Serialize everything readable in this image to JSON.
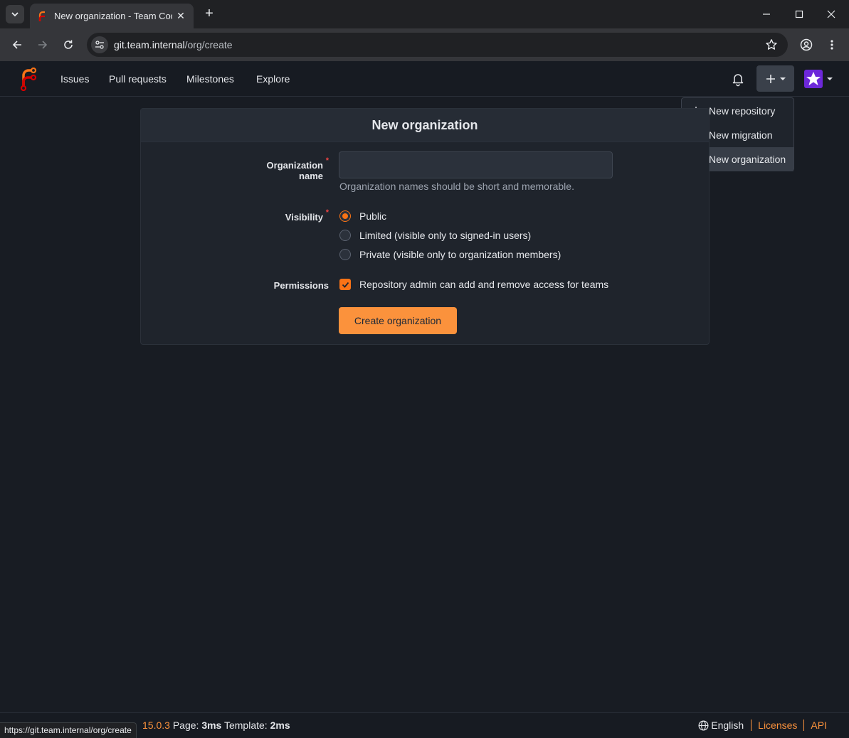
{
  "browser": {
    "tab_title": "New organization - Team Code",
    "url_host": "git.team.internal",
    "url_path": "/org/create"
  },
  "nav": {
    "items": [
      "Issues",
      "Pull requests",
      "Milestones",
      "Explore"
    ]
  },
  "create_menu": {
    "items": [
      {
        "label": "New repository",
        "icon": "plus-icon"
      },
      {
        "label": "New migration",
        "icon": "migration-icon"
      },
      {
        "label": "New organization",
        "icon": "organization-icon"
      }
    ],
    "highlighted": "New organization"
  },
  "form": {
    "title": "New organization",
    "org_name_label": "Organization name",
    "org_name_value": "",
    "org_name_help": "Organization names should be short and memorable.",
    "visibility_label": "Visibility",
    "visibility_options": [
      "Public",
      "Limited (visible only to signed-in users)",
      "Private (visible only to organization members)"
    ],
    "visibility_selected": "Public",
    "permissions_label": "Permissions",
    "permissions_option": "Repository admin can add and remove access for teams",
    "permissions_checked": true,
    "submit_label": "Create organization"
  },
  "footer": {
    "version": "15.0.3",
    "page_label": "Page:",
    "page_time": "3ms",
    "template_label": "Template:",
    "template_time": "2ms",
    "language": "English",
    "licenses": "Licenses",
    "api": "API"
  },
  "status_bar_url": "https://git.team.internal/org/create",
  "colors": {
    "accent": "#f97316",
    "button": "#fb923c",
    "background": "#181c23"
  }
}
